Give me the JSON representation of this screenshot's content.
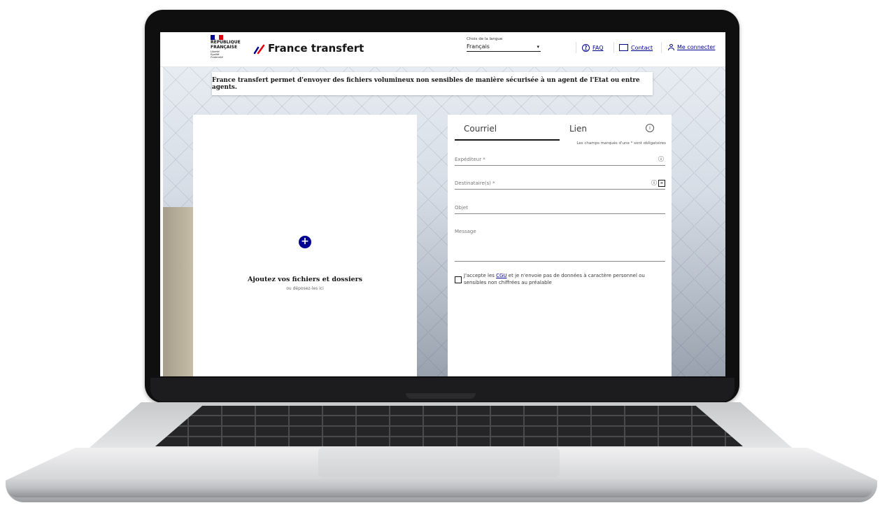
{
  "header": {
    "republic_lines": [
      "RÉPUBLIQUE",
      "FRANÇAISE"
    ],
    "motto_lines": [
      "Liberté",
      "Égalité",
      "Fraternité"
    ],
    "brand": "France transfert",
    "language_label": "Choix de la langue",
    "language_value": "Français",
    "nav": {
      "faq": "FAQ",
      "contact": "Contact",
      "login": "Me connecter"
    }
  },
  "banner": {
    "text": "France transfert permet d'envoyer des fichiers volumineux non sensibles de manière sécurisée à un agent de l'Etat ou entre agents."
  },
  "upload": {
    "title": "Ajoutez vos fichiers et dossiers",
    "subtitle": "ou déposez-les ici"
  },
  "form": {
    "tabs": [
      "Courriel",
      "Lien"
    ],
    "required_note": "Les champs marqués d'une * sont obligatoires",
    "fields": {
      "sender": "Expéditeur *",
      "recipients": "Destinataire(s) *",
      "subject": "Objet",
      "message": "Message"
    },
    "consent_prefix": "J'accepte les ",
    "consent_link": "CGU",
    "consent_suffix": " et je n'envoie pas de données à caractère personnel ou sensibles non chiffrées au préalable"
  },
  "colors": {
    "primary": "#000091",
    "flag_blue": "#000091",
    "flag_white": "#ffffff",
    "flag_red": "#e1000f"
  },
  "icons": {
    "info": "info-icon",
    "plus": "plus-icon",
    "question": "question-icon",
    "mail": "mail-icon",
    "user": "user-icon",
    "list": "list-icon"
  }
}
